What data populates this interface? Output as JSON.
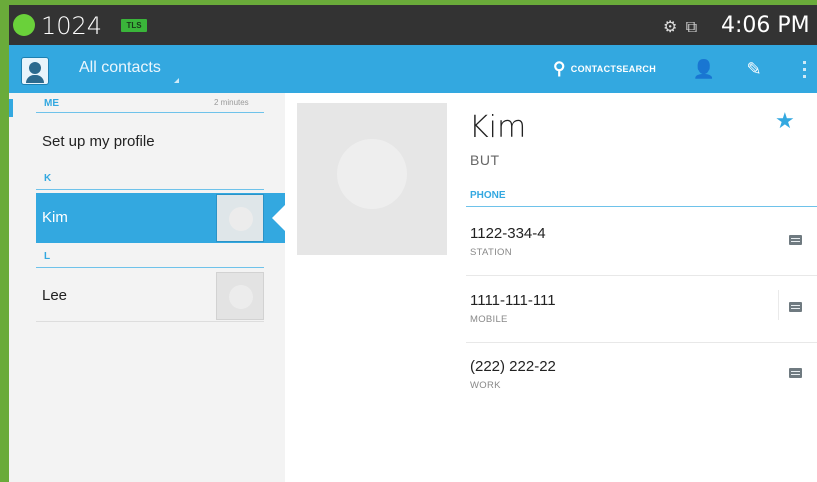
{
  "status_bar": {
    "counter": "1024",
    "badge": "TLS",
    "status_icons": "⚙ ⧉",
    "time": "4:06 PM"
  },
  "action_bar": {
    "title": "All contacts",
    "search_label": "CONTACTSEARCH"
  },
  "list": {
    "sections": [
      {
        "header": "ME",
        "sub": "2 minutes",
        "item": "Set up my profile"
      },
      {
        "header": "K",
        "item": "Kim"
      },
      {
        "header": "L",
        "item": "Lee"
      }
    ]
  },
  "detail": {
    "name": "Kim",
    "organization": "BUT",
    "phone_header": "PHONE",
    "phones": [
      {
        "number": "1122-334-4",
        "type": "STATION"
      },
      {
        "number": "1111-111-111",
        "type": "MOBILE"
      },
      {
        "number": "(222) 222-22",
        "type": "WORK"
      }
    ]
  },
  "colors": {
    "accent": "#33a8e0",
    "status_bar": "#333333",
    "frame": "#6aab3a"
  }
}
